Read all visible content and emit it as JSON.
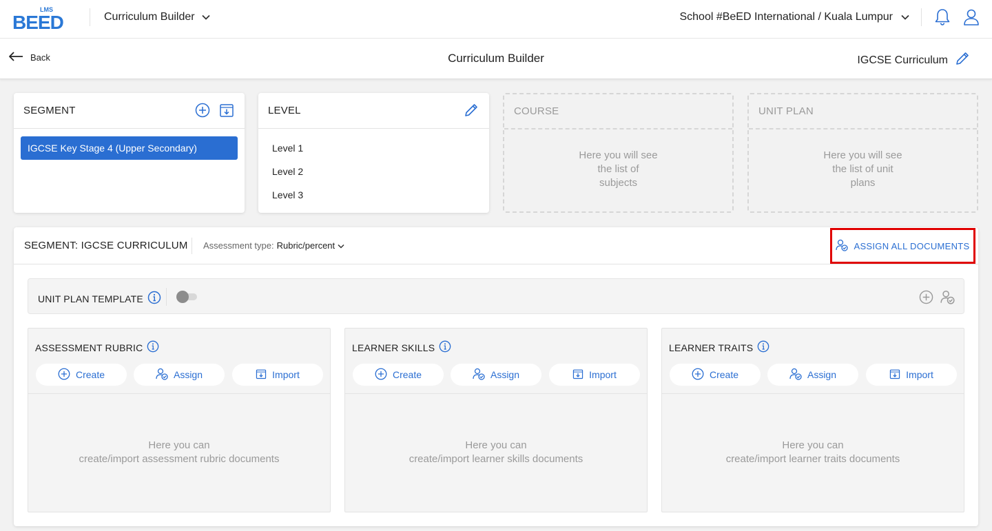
{
  "header": {
    "logo_small": "LMS",
    "logo_word": "BEED",
    "app_name": "Curriculum Builder",
    "school": "School #BeED International / Kuala Lumpur"
  },
  "subheader": {
    "back_label": "Back",
    "title": "Curriculum Builder",
    "curriculum_name": "IGCSE Curriculum"
  },
  "segment_card": {
    "title": "SEGMENT",
    "items": [
      "IGCSE Key Stage 4 (Upper Secondary)"
    ]
  },
  "level_card": {
    "title": "LEVEL",
    "items": [
      "Level 1",
      "Level 2",
      "Level 3"
    ]
  },
  "course_card": {
    "title": "COURSE",
    "placeholder": [
      "Here you will see",
      "the list of",
      "subjects"
    ]
  },
  "unitplan_card": {
    "title": "UNIT PLAN",
    "placeholder": [
      "Here you will see",
      "the list of unit",
      "plans"
    ]
  },
  "main": {
    "segment_title": "SEGMENT: IGCSE CURRICULUM",
    "assessment_label": "Assessment type:",
    "assessment_value": "Rubric/percent",
    "assign_all_label": "ASSIGN ALL DOCUMENTS",
    "template_label": "UNIT PLAN TEMPLATE",
    "template_enabled": false,
    "actions": {
      "create": "Create",
      "assign": "Assign",
      "import": "Import"
    },
    "columns": [
      {
        "title": "ASSESSMENT RUBRIC",
        "empty_1": "Here you can",
        "empty_2": "create/import assessment rubric documents"
      },
      {
        "title": "LEARNER SKILLS",
        "empty_1": "Here you can",
        "empty_2": "create/import learner skills documents"
      },
      {
        "title": "LEARNER TRAITS",
        "empty_1": "Here you can",
        "empty_2": "create/import learner traits documents"
      }
    ]
  },
  "colors": {
    "accent": "#2a6ed2",
    "highlight": "#e00000",
    "muted": "#9a9a9a"
  }
}
